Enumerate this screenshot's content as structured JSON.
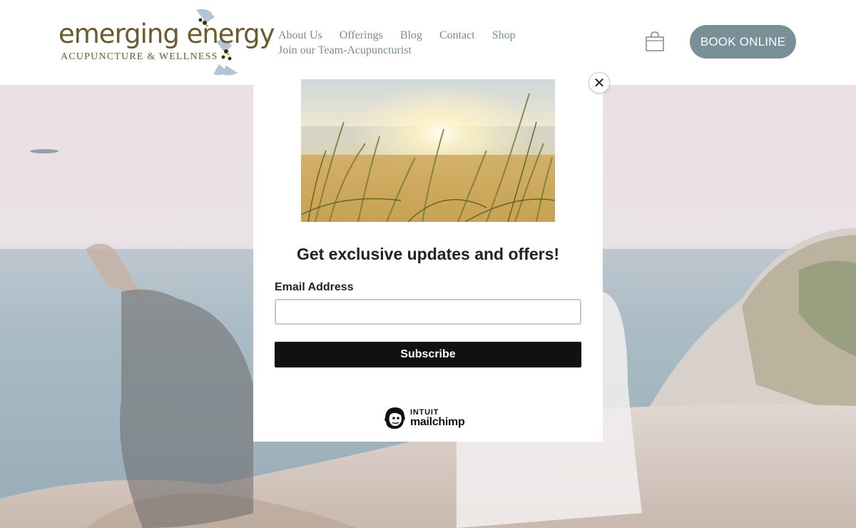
{
  "brand": {
    "name": "emerging energy",
    "tagline": "ACUPUNCTURE & WELLNESS"
  },
  "nav": {
    "row1": [
      "About Us",
      "Offerings",
      "Blog",
      "Contact",
      "Shop"
    ],
    "row2": [
      "Join our Team-Acupuncturist"
    ]
  },
  "header": {
    "book_label": "BOOK ONLINE",
    "cart_icon": "shopping-bag-icon"
  },
  "colors": {
    "brand_brown": "#6d5a2c",
    "nav_gray": "#7a8b94",
    "button_slate": "#7a9099",
    "subscribe_black": "#111111"
  },
  "popup": {
    "close_symbol": "✕",
    "title": "Get exclusive updates and offers!",
    "email_label": "Email Address",
    "email_value": "",
    "subscribe_label": "Subscribe",
    "badge_top": "INTUIT",
    "badge_name": "mailchimp"
  }
}
